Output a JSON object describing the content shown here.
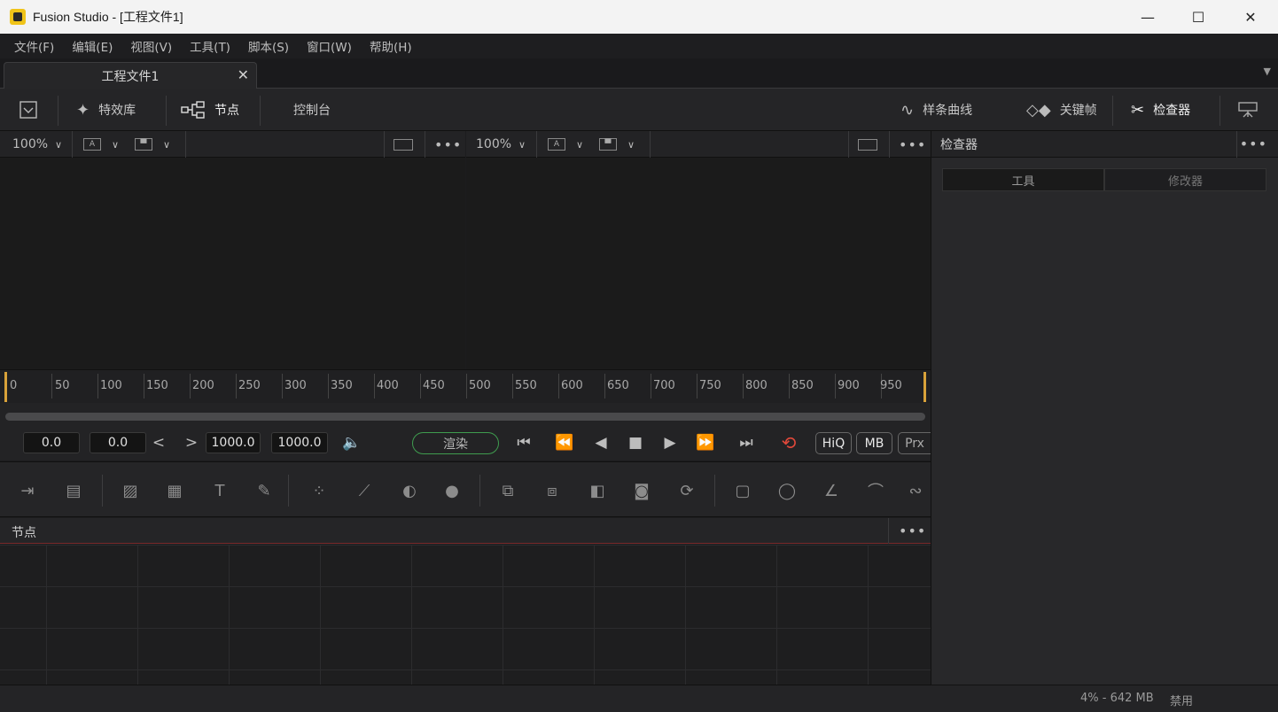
{
  "window": {
    "title": "Fusion Studio - [工程文件1]",
    "minimize": "—",
    "maximize": "☐",
    "close": "✕"
  },
  "menu": [
    "文件(F)",
    "编辑(E)",
    "视图(V)",
    "工具(T)",
    "脚本(S)",
    "窗口(W)",
    "帮助(H)"
  ],
  "tabs": {
    "active": "工程文件1",
    "close": "✕",
    "overflow": "▼"
  },
  "toolbar": {
    "effects": "特效库",
    "nodes": "节点",
    "console": "控制台",
    "spline": "样条曲线",
    "keyframes": "关键帧",
    "inspector": "检查器"
  },
  "viewer_left": {
    "zoom": "100%",
    "chev": "∨"
  },
  "viewer_right": {
    "zoom": "100%",
    "chev": "∨"
  },
  "inspector": {
    "title": "检查器",
    "tab_tools": "工具",
    "tab_modifiers": "修改器"
  },
  "ruler": {
    "labels": [
      "0",
      "50",
      "100",
      "150",
      "200",
      "250",
      "300",
      "350",
      "400",
      "450",
      "500",
      "550",
      "600",
      "650",
      "700",
      "750",
      "800",
      "850",
      "900",
      "950"
    ]
  },
  "transport": {
    "render_start": "0.0",
    "global_start": "0.0",
    "render_end": "1000.0",
    "global_end": "1000.0",
    "render": "渲染",
    "hiq": "HiQ",
    "mb": "MB",
    "prx": "Prx",
    "prev": "<",
    "next": ">"
  },
  "nodes_panel": {
    "title": "节点"
  },
  "status": {
    "memory": "4% -  642 MB",
    "state": "禁用"
  },
  "colors": {
    "accent_gold": "#d9a23a",
    "render_border": "#3f9c4f",
    "loop_red": "#e0483a"
  }
}
